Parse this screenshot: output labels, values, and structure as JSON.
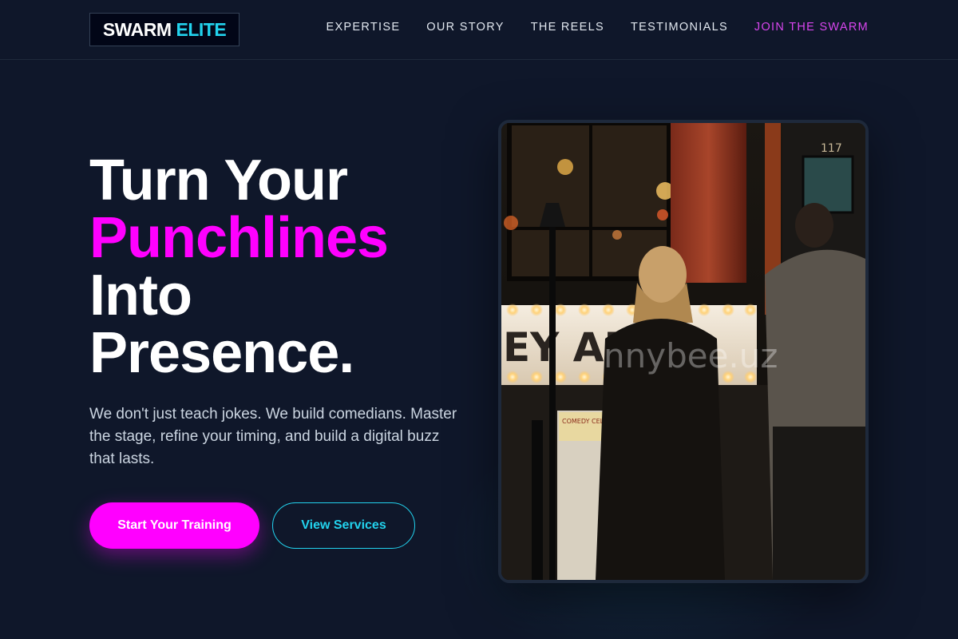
{
  "header": {
    "logo_part1": "SWARM",
    "logo_part2": "ELITE",
    "nav": [
      {
        "label": "EXPERTISE"
      },
      {
        "label": "OUR STORY"
      },
      {
        "label": "THE REELS"
      },
      {
        "label": "TESTIMONIALS"
      },
      {
        "label": "JOIN THE SWARM"
      }
    ]
  },
  "hero": {
    "headline": [
      "Turn Your",
      "Punchlines",
      "Into",
      "Presence."
    ],
    "subtext": "We don't just teach jokes. We build comedians. Master the stage, refine your timing, and build a digital buzz that lasts.",
    "primary_cta": "Start Your Training",
    "secondary_cta": "View Services",
    "image_watermark": "nnybee.uz",
    "image_sign_text": "EY  AR",
    "image_door_number": "117",
    "image_poster_text": "COMEDY CELLAR"
  },
  "colors": {
    "background": "#0f172a",
    "accent_pink": "#ff00ff",
    "accent_cyan": "#22d3ee",
    "nav_accent": "#d946ef"
  }
}
